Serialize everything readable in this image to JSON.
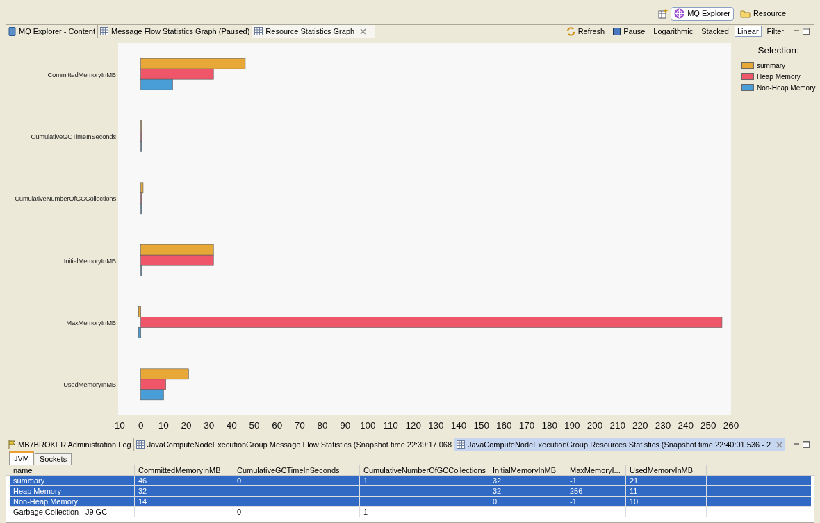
{
  "perspective_bar": {
    "buttons": [
      {
        "label": "MQ Explorer",
        "selected": true
      },
      {
        "label": "Resource",
        "selected": false
      }
    ]
  },
  "editor_tabs": [
    {
      "label": "MQ Explorer - Content",
      "kind": "content",
      "selected": false
    },
    {
      "label": "Message Flow Statistics Graph (Paused)",
      "kind": "graph",
      "selected": false
    },
    {
      "label": "Resource Statistics Graph",
      "kind": "graph",
      "selected": true
    }
  ],
  "toolbar": [
    {
      "label": "Refresh",
      "kind": "refresh",
      "selected": false
    },
    {
      "label": "Pause",
      "kind": "pause",
      "selected": false
    },
    {
      "label": "Logarithmic",
      "kind": "option",
      "selected": false
    },
    {
      "label": "Stacked",
      "kind": "option",
      "selected": false
    },
    {
      "label": "Linear",
      "kind": "option",
      "selected": true
    },
    {
      "label": "Filter",
      "kind": "option",
      "selected": false
    }
  ],
  "chart_data": {
    "type": "bar",
    "orientation": "horizontal",
    "legend_title": "Selection:",
    "categories": [
      "CommittedMemoryInMB",
      "CumulativeGCTimeInSeconds",
      "CumulativeNumberOfGCCollections",
      "InitialMemoryInMB",
      "MaxMemoryInMB",
      "UsedMemoryInMB"
    ],
    "series": [
      {
        "name": "summary",
        "color": "#e8a838",
        "values": [
          46,
          0,
          1,
          32,
          -1,
          21
        ]
      },
      {
        "name": "Heap Memory",
        "color": "#f0566a",
        "values": [
          32,
          0,
          0,
          32,
          256,
          11
        ]
      },
      {
        "name": "Non-Heap Memory",
        "color": "#4a9ed8",
        "values": [
          14,
          0,
          0,
          0,
          -1,
          10
        ]
      }
    ],
    "xlim": [
      -10,
      260
    ],
    "xticks": [
      -10,
      0,
      10,
      20,
      30,
      40,
      50,
      60,
      70,
      80,
      90,
      100,
      110,
      120,
      130,
      140,
      150,
      160,
      170,
      180,
      190,
      200,
      210,
      220,
      230,
      240,
      250,
      260
    ]
  },
  "bottom_tabs": [
    {
      "label": "MB7BROKER  Administration Log",
      "kind": "log",
      "selected": false
    },
    {
      "label": "JavaComputeNodeExecutionGroup Message Flow Statistics (Snapshot time 22:39:17.068",
      "kind": "table",
      "selected": false
    },
    {
      "label": "JavaComputeNodeExecutionGroup Resources Statistics (Snapshot time 22:40:01.536 - 2",
      "kind": "table",
      "selected": true
    }
  ],
  "sub_tabs": [
    {
      "label": "JVM",
      "selected": true
    },
    {
      "label": "Sockets",
      "selected": false
    }
  ],
  "table": {
    "columns": [
      "name",
      "CommittedMemoryInMB",
      "CumulativeGCTimeInSeconds",
      "CumulativeNumberOfGCCollections",
      "InitialMemoryInMB",
      "MaxMemoryI...",
      "UsedMemoryInMB"
    ],
    "rows": [
      {
        "cells": [
          "summary",
          "46",
          "0",
          "1",
          "32",
          "-1",
          "21"
        ],
        "selected": true
      },
      {
        "cells": [
          "Heap Memory",
          "32",
          "",
          "",
          "32",
          "256",
          "11"
        ],
        "selected": true
      },
      {
        "cells": [
          "Non-Heap Memory",
          "14",
          "",
          "",
          "0",
          "-1",
          "10"
        ],
        "selected": true
      },
      {
        "cells": [
          "Garbage Collection - J9 GC",
          "",
          "0",
          "1",
          "",
          "",
          ""
        ],
        "selected": false
      }
    ]
  }
}
